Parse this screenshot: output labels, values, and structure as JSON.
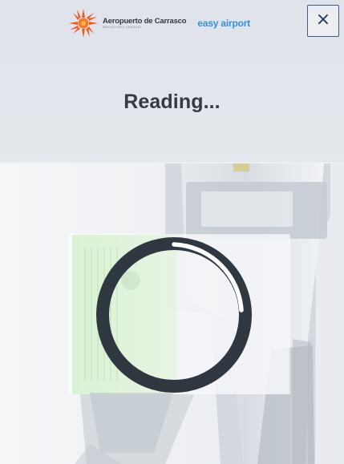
{
  "header": {
    "airport_name": "Aeropuerto de Carrasco",
    "airport_subtitle": "MONTEVIDEO URUGUAY",
    "partner_brand_prefix": "e",
    "partner_brand_rest": "asy airport",
    "close_label": "×"
  },
  "status": {
    "title": "Reading..."
  },
  "icons": {
    "airport_logo": "sun-logo-icon",
    "close": "close-icon",
    "progress": "loading-ring-icon"
  },
  "colors": {
    "header_background": "#dfe3ea",
    "title_text": "#353b44",
    "close_border": "#405d82",
    "spinner_ring": "#2f3741",
    "spinner_highlight": "#ffffff",
    "partner_blue": "#2a8ed7",
    "airport_orange": "#ef5a1d"
  }
}
